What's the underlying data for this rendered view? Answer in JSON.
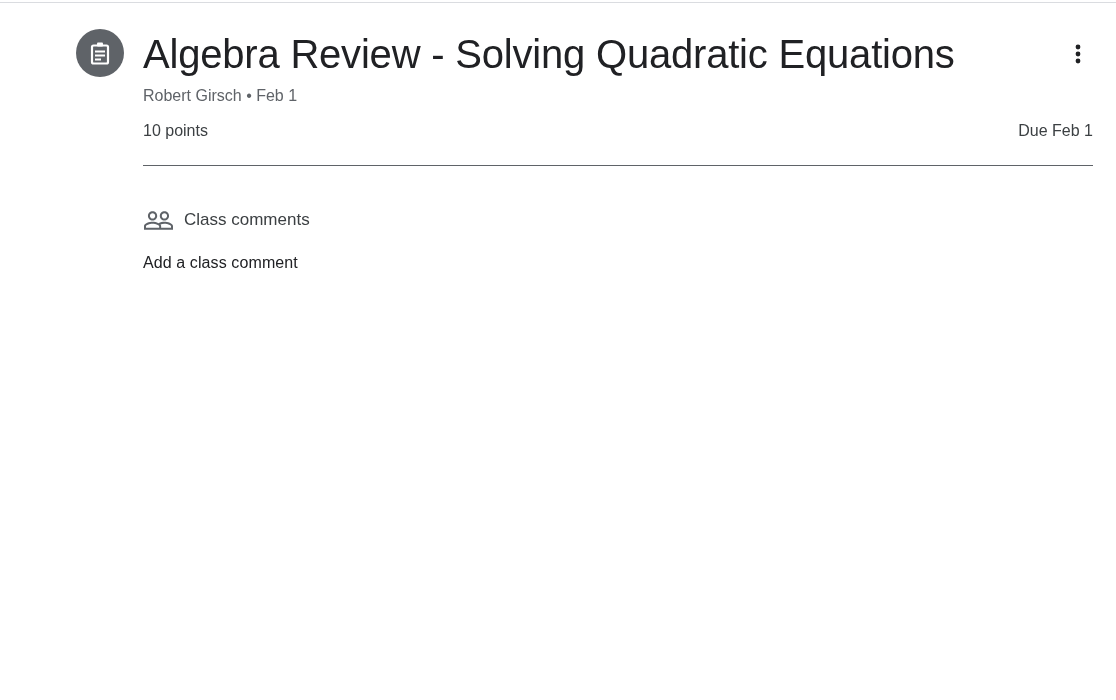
{
  "assignment": {
    "title": "Algebra Review - Solving Quadratic Equations",
    "byline": "Robert Girsch • Feb 1",
    "points": "10 points",
    "due": "Due Feb 1"
  },
  "class_comments": {
    "heading": "Class comments",
    "add_comment": "Add a class comment"
  }
}
